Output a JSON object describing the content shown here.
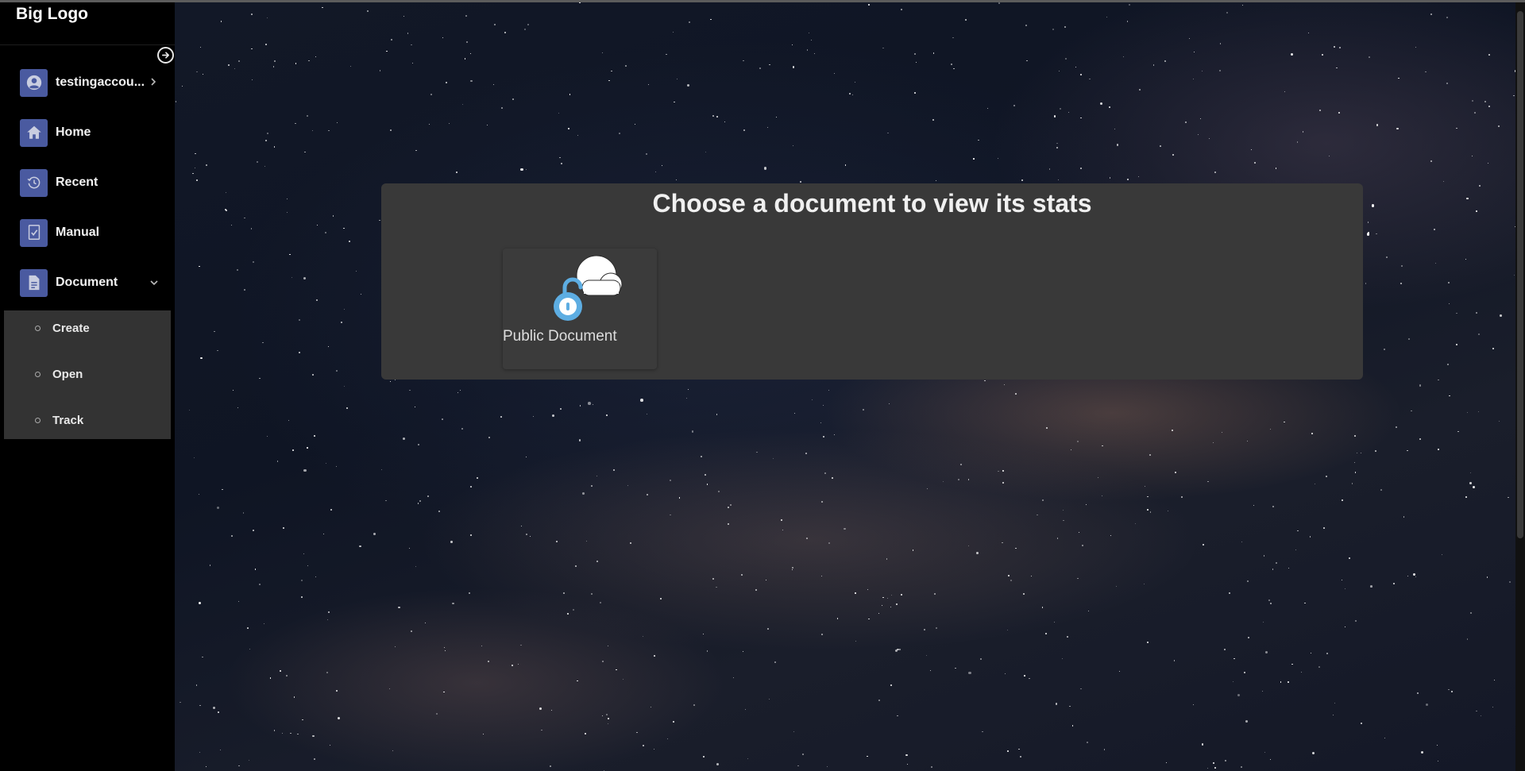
{
  "app": {
    "logo": "Big Logo"
  },
  "sidebar": {
    "items": [
      {
        "label": "testingaccou...",
        "icon": "user-circle-icon"
      },
      {
        "label": "Home",
        "icon": "home-icon"
      },
      {
        "label": "Recent",
        "icon": "history-icon"
      },
      {
        "label": "Manual",
        "icon": "file-check-icon"
      },
      {
        "label": "Document",
        "icon": "document-icon"
      }
    ],
    "submenu": [
      {
        "label": "Create"
      },
      {
        "label": "Open"
      },
      {
        "label": "Track"
      }
    ]
  },
  "main": {
    "title": "Choose a document to view its stats",
    "documents": [
      {
        "label": "Public Document",
        "icon": "cloud-unlocked-icon"
      }
    ]
  },
  "colors": {
    "sidebar_bg": "#000000",
    "icon_bg": "#4a5aa0",
    "panel_bg": "#393939",
    "lock_accent": "#5dade2"
  }
}
